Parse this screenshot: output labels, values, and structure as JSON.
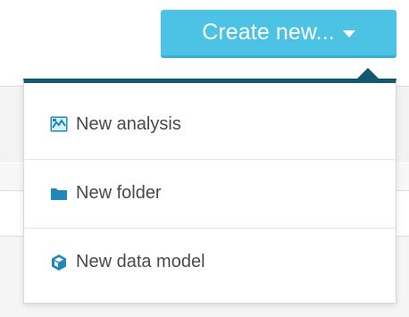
{
  "header": {
    "create_button_label": "Create new..."
  },
  "menu": {
    "items": [
      {
        "label": "New analysis",
        "icon": "analysis-icon"
      },
      {
        "label": "New folder",
        "icon": "folder-icon"
      },
      {
        "label": "New data model",
        "icon": "data-model-cube-icon"
      }
    ]
  },
  "colors": {
    "button": "#4cc3e5",
    "menu_top_border": "#14586f",
    "icon": "#1f88b8",
    "text": "#4a4a4a"
  }
}
